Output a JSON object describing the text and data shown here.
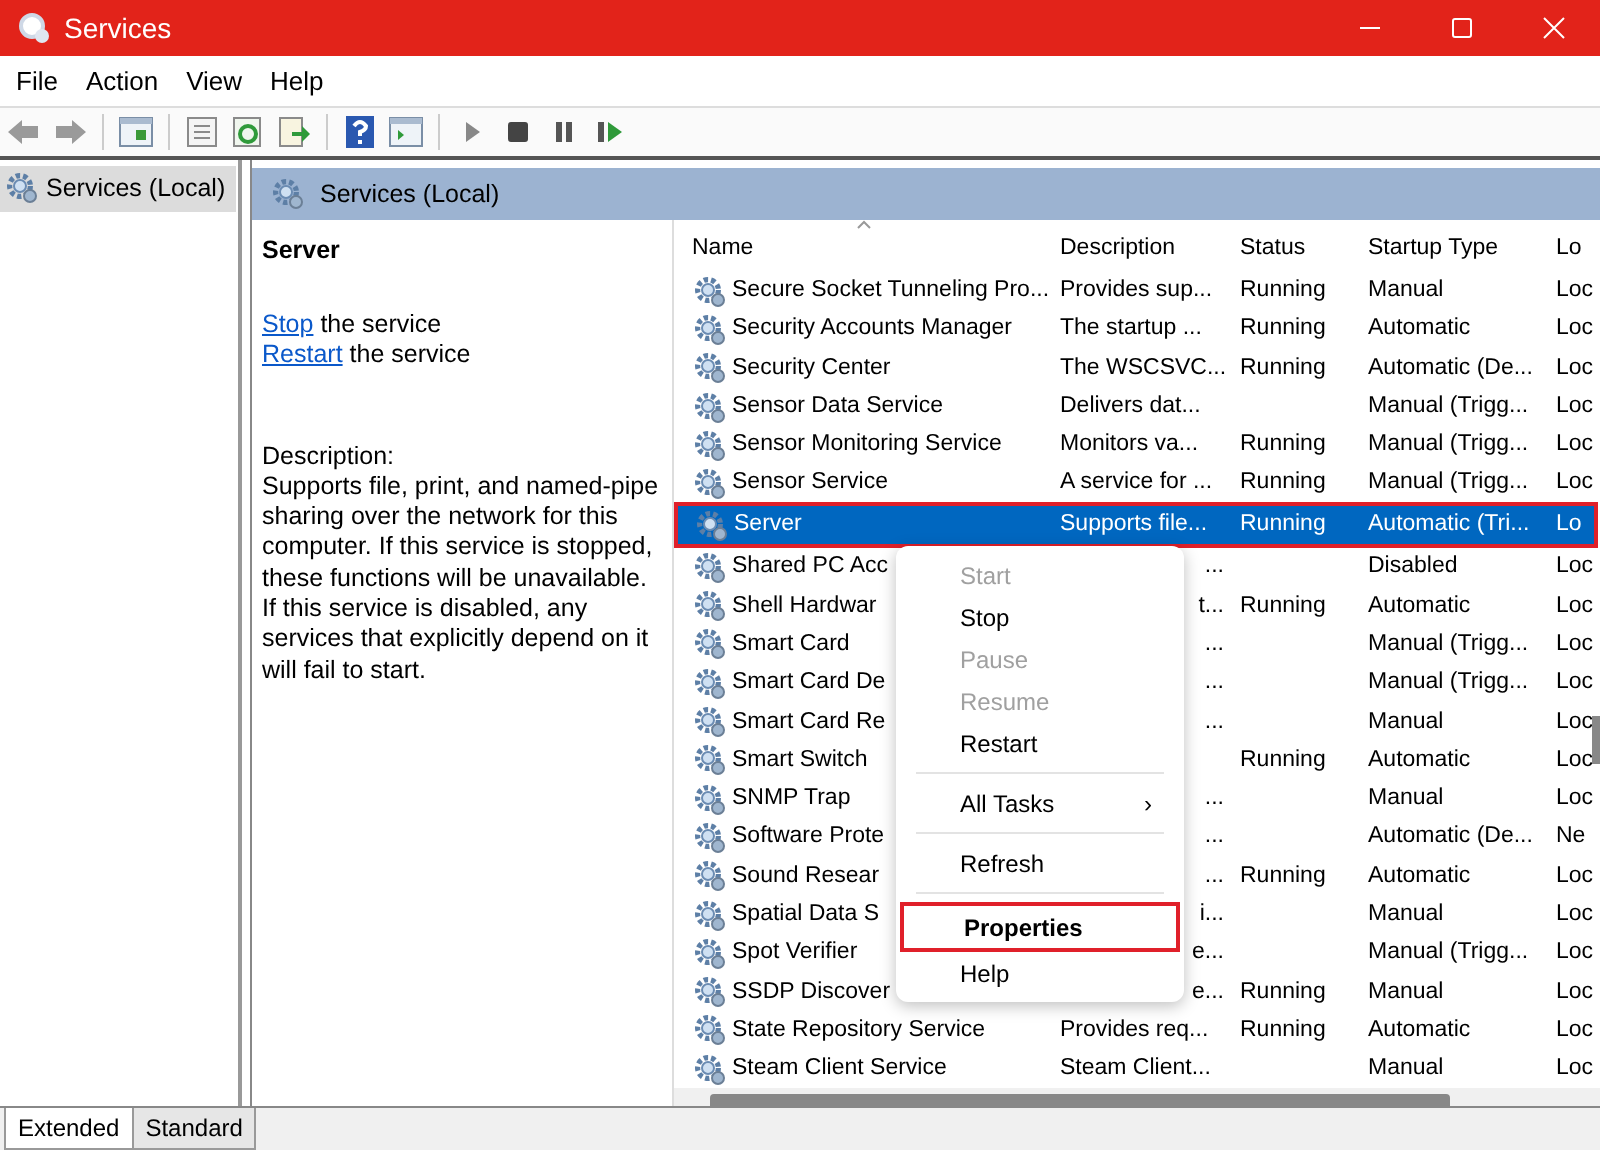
{
  "window": {
    "title": "Services"
  },
  "menu": [
    "File",
    "Action",
    "View",
    "Help"
  ],
  "tree": [
    {
      "label": "Services (Local)",
      "selected": true
    }
  ],
  "pane_title": "Services (Local)",
  "details": {
    "title": "Server",
    "actions": [
      {
        "link": "Stop",
        "text": "the service"
      },
      {
        "link": "Restart",
        "text": "the service"
      }
    ],
    "description_label": "Description:",
    "description": "Supports file, print, and named-pipe sharing over the network for this computer. If this service is stopped, these functions will be unavailable. If this service is disabled, any services that explicitly depend on it will fail to start."
  },
  "table": {
    "columns": [
      {
        "label": "Name",
        "sorted": true
      },
      {
        "label": "Description"
      },
      {
        "label": "Status"
      },
      {
        "label": "Startup Type"
      },
      {
        "label": "Lo"
      }
    ],
    "rows": [
      {
        "name": "Secure Socket Tunneling Pro...",
        "description": "Provides sup...",
        "status": "Running",
        "startup": "Manual",
        "logon": "Loc",
        "selected": false,
        "outlined": false
      },
      {
        "name": "Security Accounts Manager",
        "description": "The startup ...",
        "status": "Running",
        "startup": "Automatic",
        "logon": "Loc",
        "selected": false,
        "outlined": false
      },
      {
        "name": "Security Center",
        "description": "The WSCSVC...",
        "status": "Running",
        "startup": "Automatic (De...",
        "logon": "Loc",
        "selected": false,
        "outlined": false
      },
      {
        "name": "Sensor Data Service",
        "description": "Delivers dat...",
        "startup": "Manual (Trigg...",
        "logon": "Loc",
        "selected": false,
        "outlined": false
      },
      {
        "name": "Sensor Monitoring Service",
        "description": "Monitors va...",
        "status": "Running",
        "startup": "Manual (Trigg...",
        "logon": "Loc",
        "selected": false,
        "outlined": false
      },
      {
        "name": "Sensor Service",
        "description": "A service for ...",
        "status": "Running",
        "startup": "Manual (Trigg...",
        "logon": "Loc",
        "selected": false,
        "outlined": false
      },
      {
        "name": "Server",
        "description": "Supports file...",
        "status": "Running",
        "startup": "Automatic (Tri...",
        "logon": "Lo",
        "selected": true,
        "outlined": true
      },
      {
        "name": "Shared PC Acc",
        "description": "...",
        "startup": "Disabled",
        "logon": "Loc",
        "selected": false,
        "outlined": false
      },
      {
        "name": "Shell Hardwar",
        "description": "t...",
        "status": "Running",
        "startup": "Automatic",
        "logon": "Loc",
        "selected": false,
        "outlined": false
      },
      {
        "name": "Smart Card",
        "description": "...",
        "startup": "Manual (Trigg...",
        "logon": "Loc",
        "selected": false,
        "outlined": false
      },
      {
        "name": "Smart Card De",
        "description": "...",
        "startup": "Manual (Trigg...",
        "logon": "Loc",
        "selected": false,
        "outlined": false
      },
      {
        "name": "Smart Card Re",
        "description": "...",
        "startup": "Manual",
        "logon": "Loc",
        "selected": false,
        "outlined": false
      },
      {
        "name": "Smart Switch",
        "status": "Running",
        "startup": "Automatic",
        "logon": "Loc",
        "selected": false,
        "outlined": false
      },
      {
        "name": "SNMP Trap",
        "description": "...",
        "startup": "Manual",
        "logon": "Loc",
        "selected": false,
        "outlined": false
      },
      {
        "name": "Software Prote",
        "description": "...",
        "startup": "Automatic (De...",
        "logon": "Ne",
        "selected": false,
        "outlined": false
      },
      {
        "name": "Sound Resear",
        "description": "...",
        "status": "Running",
        "startup": "Automatic",
        "logon": "Loc",
        "selected": false,
        "outlined": false
      },
      {
        "name": "Spatial Data S",
        "description": "i...",
        "startup": "Manual",
        "logon": "Loc",
        "selected": false,
        "outlined": false
      },
      {
        "name": "Spot Verifier",
        "description": "e...",
        "startup": "Manual (Trigg...",
        "logon": "Loc",
        "selected": false,
        "outlined": false
      },
      {
        "name": "SSDP Discover",
        "description": "e...",
        "status": "Running",
        "startup": "Manual",
        "logon": "Loc",
        "selected": false,
        "outlined": false
      },
      {
        "name": "State Repository Service",
        "description": "Provides req...",
        "status": "Running",
        "startup": "Automatic",
        "logon": "Loc",
        "selected": false,
        "outlined": false
      },
      {
        "name": "Steam Client Service",
        "description": "Steam Client...",
        "startup": "Manual",
        "logon": "Loc",
        "selected": false,
        "outlined": false
      }
    ]
  },
  "context_menu": {
    "items": [
      {
        "kind": "item",
        "label": "Start",
        "disabled": true,
        "default": false,
        "outlined": false
      },
      {
        "kind": "item",
        "label": "Stop",
        "disabled": false,
        "default": false,
        "outlined": false
      },
      {
        "kind": "item",
        "label": "Pause",
        "disabled": true,
        "default": false,
        "outlined": false
      },
      {
        "kind": "item",
        "label": "Resume",
        "disabled": true,
        "default": false,
        "outlined": false
      },
      {
        "kind": "item",
        "label": "Restart",
        "disabled": false,
        "default": false,
        "outlined": false
      },
      {
        "kind": "separator"
      },
      {
        "kind": "submenu",
        "label": "All Tasks",
        "arrow": "›",
        "disabled": false,
        "default": false,
        "outlined": false
      },
      {
        "kind": "separator"
      },
      {
        "kind": "item",
        "label": "Refresh",
        "disabled": false,
        "default": false,
        "outlined": false
      },
      {
        "kind": "separator"
      },
      {
        "kind": "item",
        "label": "Properties",
        "disabled": false,
        "default": true,
        "outlined": true
      },
      {
        "kind": "item",
        "label": "Help",
        "disabled": false,
        "default": false,
        "outlined": false
      }
    ]
  },
  "bottom_tabs": [
    {
      "label": "Extended",
      "selected": true
    },
    {
      "label": "Standard",
      "selected": false
    }
  ]
}
